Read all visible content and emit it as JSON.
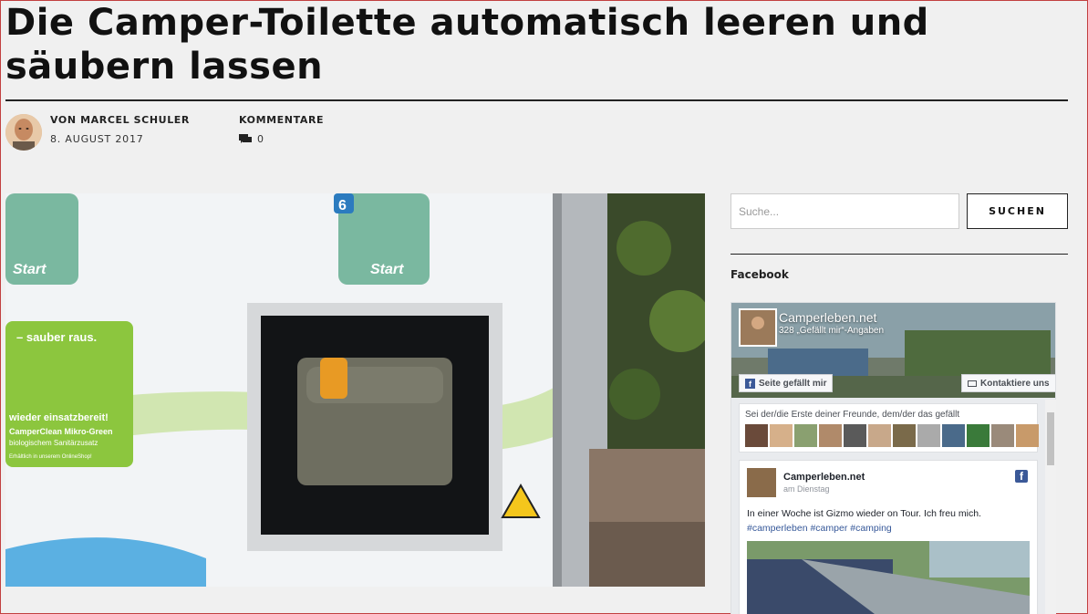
{
  "article": {
    "title": "Die Camper-Toilette automatisch leeren und säubern lassen",
    "author_label": "VON MARCEL SCHULER",
    "date": "8. AUGUST 2017",
    "comments_label": "KOMMENTARE",
    "comments_count": "0"
  },
  "hero_image": {
    "caption_texts": [
      "Start",
      "Start",
      "6",
      "– sauber raus.",
      "wieder einsatzbereit!",
      "CamperClean Mikro-Green",
      "biologischem Sanitärzusatz",
      "Erhältlich in unserem OnlineShop!"
    ]
  },
  "sidebar": {
    "search_placeholder": "Suche...",
    "search_button": "SUCHEN",
    "facebook_heading": "Facebook"
  },
  "facebook": {
    "page_name": "Camperleben.net",
    "page_likes": "328 „Gefällt mir“-Angaben",
    "like_button": "Seite gefällt mir",
    "contact_button": "Kontaktiere uns",
    "friends_text": "Sei der/die Erste deiner Freunde, dem/der das gefällt",
    "post": {
      "author": "Camperleben.net",
      "date": "am Dienstag",
      "text": "In einer Woche ist Gizmo wieder on Tour. Ich freu mich.",
      "tags": "#camperleben #camper #camping"
    }
  },
  "colors": {
    "accent_fb": "#3b5998",
    "background": "#f0f0f0"
  }
}
